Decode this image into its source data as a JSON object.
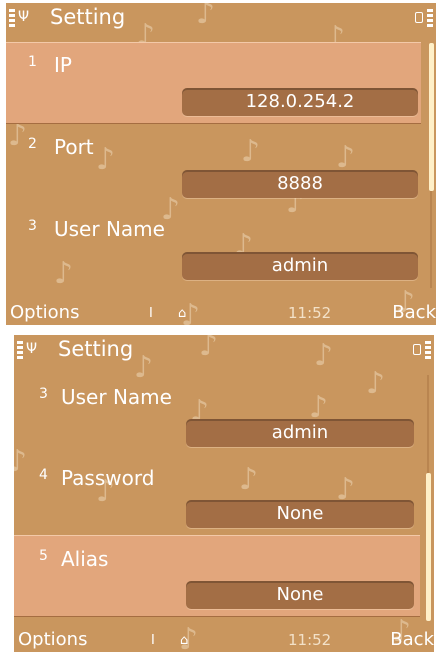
{
  "screens": [
    {
      "title": "Setting",
      "items": [
        {
          "number": "1",
          "label": "IP",
          "value": "128.0.254.2",
          "selected": true
        },
        {
          "number": "2",
          "label": "Port",
          "value": "8888",
          "selected": false
        },
        {
          "number": "3",
          "label": "User Name",
          "value": "admin",
          "selected": false
        }
      ],
      "softkeys": {
        "left": "Options",
        "clock": "11:52",
        "right": "Back"
      }
    },
    {
      "title": "Setting",
      "items": [
        {
          "number": "3",
          "label": "User Name",
          "value": "admin",
          "selected": false
        },
        {
          "number": "4",
          "label": "Password",
          "value": "None",
          "selected": false
        },
        {
          "number": "5",
          "label": "Alias",
          "value": "None",
          "selected": true
        }
      ],
      "softkeys": {
        "left": "Options",
        "clock": "11:52",
        "right": "Back"
      }
    }
  ],
  "icons": {
    "signal": "signal-strength-icon",
    "antenna": "antenna-icon",
    "battery": "battery-level-icon",
    "input_mode": "text-input-icon",
    "keypad_lock": "keypad-icon"
  },
  "colors": {
    "background": "#c9965e",
    "highlight": "#e2a67c",
    "field": "#a36e45",
    "text": "#ffffff",
    "notes": "#ddb98e",
    "scrollbar": "#fff0c8"
  }
}
